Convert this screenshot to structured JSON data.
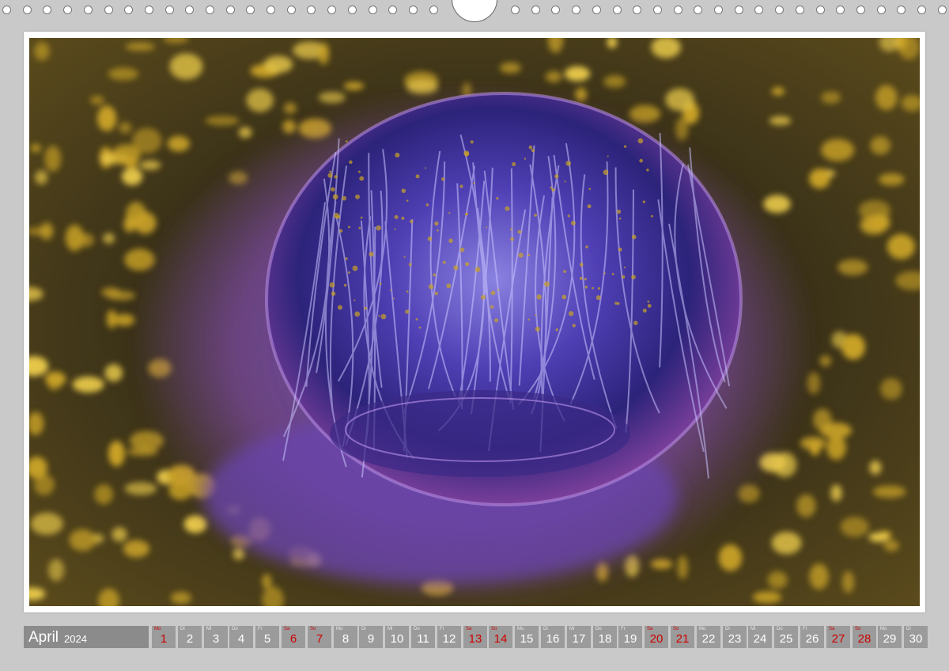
{
  "calendar": {
    "month": "April",
    "year": "2024",
    "weekend_color": "#cc0000",
    "days": [
      {
        "wd": "Mo",
        "num": "1",
        "we": true
      },
      {
        "wd": "Di",
        "num": "2",
        "we": false
      },
      {
        "wd": "Mi",
        "num": "3",
        "we": false
      },
      {
        "wd": "Do",
        "num": "4",
        "we": false
      },
      {
        "wd": "Fr",
        "num": "5",
        "we": false
      },
      {
        "wd": "Sa",
        "num": "6",
        "we": true
      },
      {
        "wd": "So",
        "num": "7",
        "we": true
      },
      {
        "wd": "Mo",
        "num": "8",
        "we": false
      },
      {
        "wd": "Di",
        "num": "9",
        "we": false
      },
      {
        "wd": "Mi",
        "num": "10",
        "we": false
      },
      {
        "wd": "Do",
        "num": "11",
        "we": false
      },
      {
        "wd": "Fr",
        "num": "12",
        "we": false
      },
      {
        "wd": "Sa",
        "num": "13",
        "we": true
      },
      {
        "wd": "So",
        "num": "14",
        "we": true
      },
      {
        "wd": "Mo",
        "num": "15",
        "we": false
      },
      {
        "wd": "Di",
        "num": "16",
        "we": false
      },
      {
        "wd": "Mi",
        "num": "17",
        "we": false
      },
      {
        "wd": "Do",
        "num": "18",
        "we": false
      },
      {
        "wd": "Fr",
        "num": "19",
        "we": false
      },
      {
        "wd": "Sa",
        "num": "20",
        "we": true
      },
      {
        "wd": "So",
        "num": "21",
        "we": true
      },
      {
        "wd": "Mo",
        "num": "22",
        "we": false
      },
      {
        "wd": "Di",
        "num": "23",
        "we": false
      },
      {
        "wd": "Mi",
        "num": "24",
        "we": false
      },
      {
        "wd": "Do",
        "num": "25",
        "we": false
      },
      {
        "wd": "Fr",
        "num": "26",
        "we": false
      },
      {
        "wd": "Sa",
        "num": "27",
        "we": true
      },
      {
        "wd": "So",
        "num": "28",
        "we": true
      },
      {
        "wd": "Mo",
        "num": "29",
        "we": false
      },
      {
        "wd": "Di",
        "num": "30",
        "we": false
      }
    ]
  },
  "photo": {
    "subject": "jellyfish-photo",
    "colors": {
      "gold": "#c9a227",
      "violet": "#5a3fb0",
      "blue": "#2b3fa0",
      "magenta": "#a04aa8",
      "dark": "#2a2414"
    }
  }
}
